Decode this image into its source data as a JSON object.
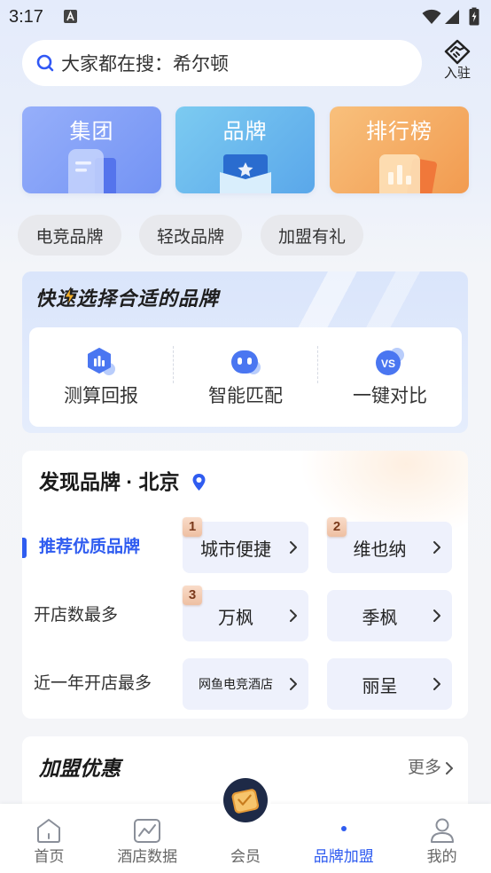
{
  "status_bar": {
    "time": "3:17",
    "notification_icon": "text-a-icon",
    "wifi_icon": "wifi-icon",
    "signal_icon": "signal-icon",
    "battery_icon": "battery-charging-icon"
  },
  "search": {
    "icon": "search-icon",
    "hint": "大家都在搜：希尔顿"
  },
  "settle_in": {
    "icon": "handshake-diamond-icon",
    "label": "入驻"
  },
  "categories": [
    {
      "label": "集团",
      "icon": "group-building-icon",
      "color": "#7f9cf7"
    },
    {
      "label": "品牌",
      "icon": "brand-star-box-icon",
      "color": "#65b6ee"
    },
    {
      "label": "排行榜",
      "icon": "ranking-chart-icon",
      "color": "#f4a95d"
    }
  ],
  "chips": [
    {
      "label": "电竞品牌"
    },
    {
      "label": "轻改品牌"
    },
    {
      "label": "加盟有礼"
    }
  ],
  "quick_select": {
    "title": "快速选择合适的品牌",
    "items": [
      {
        "label": "测算回报",
        "icon": "return-calculator-icon"
      },
      {
        "label": "智能匹配",
        "icon": "robot-match-icon"
      },
      {
        "label": "一键对比",
        "icon": "vs-compare-icon",
        "badge": "VS"
      }
    ]
  },
  "discover": {
    "title": "发现品牌 · 北京",
    "location_icon": "location-pin-icon",
    "rows": [
      {
        "label": "推荐优质品牌",
        "active": true,
        "brands": [
          {
            "rank": "1",
            "name": "城市便捷"
          },
          {
            "rank": "2",
            "name": "维也纳"
          }
        ]
      },
      {
        "label": "开店数最多",
        "active": false,
        "brands": [
          {
            "rank": "3",
            "name": "万枫"
          },
          {
            "name": "季枫"
          }
        ]
      },
      {
        "label": "近一年开店最多",
        "active": false,
        "brands": [
          {
            "name": "网鱼电竞酒店"
          },
          {
            "name": "丽呈"
          }
        ]
      }
    ]
  },
  "franchise_offers": {
    "title": "加盟优惠",
    "more_label": "更多"
  },
  "bottom_nav": {
    "items": [
      {
        "label": "首页",
        "icon": "home-icon",
        "active": false
      },
      {
        "label": "酒店数据",
        "icon": "chart-icon",
        "active": false
      },
      {
        "label": "会员",
        "icon": "member-card-icon",
        "active": false
      },
      {
        "label": "品牌加盟",
        "icon": "active-dot-icon",
        "active": true
      },
      {
        "label": "我的",
        "icon": "person-icon",
        "active": false
      }
    ]
  },
  "colors": {
    "accent": "#2f5cf0",
    "page_bg": "#f4f5f8",
    "chip_bg": "#e8e9ed",
    "brand_button_bg": "#eef1fc",
    "rank_badge_bg": "#f7d3bf",
    "quick_select_bg": "#dfe8fb"
  }
}
